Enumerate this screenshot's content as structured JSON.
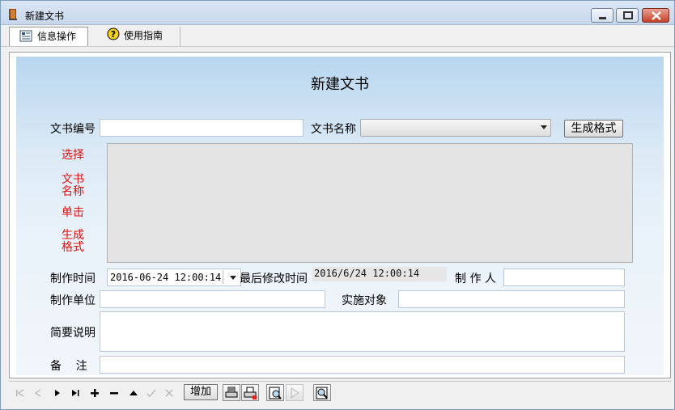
{
  "window": {
    "title": "新建文书"
  },
  "tabs": [
    {
      "label": "信息操作",
      "icon": "info-list-icon"
    },
    {
      "label": "使用指南",
      "icon": "help-icon"
    }
  ],
  "form": {
    "title": "新建文书",
    "doc_number_label": "文书编号",
    "doc_number_value": "",
    "doc_name_label": "文书名称",
    "doc_name_value": "",
    "generate_button": "生成格式",
    "hint_lines": [
      "选择",
      "文书\n名称",
      "单击",
      "生成\n格式"
    ],
    "created_time_label": "制作时间",
    "created_time_value": "2016-06-24 12:00:14",
    "modified_time_label": "最后修改时间",
    "modified_time_value": "2016/6/24 12:00:14",
    "author_label": "制 作 人",
    "author_value": "",
    "unit_label": "制作单位",
    "unit_value": "",
    "target_label": "实施对象",
    "target_value": "",
    "summary_label": "简要说明",
    "summary_value": "",
    "remark_label": "备    注",
    "remark_value": ""
  },
  "navigator": {
    "add_label": "增加",
    "buttons": [
      "first-record-icon",
      "prev-record-icon",
      "next-record-icon",
      "last-record-icon",
      "insert-record-icon",
      "delete-record-icon",
      "edit-record-icon",
      "post-record-icon",
      "cancel-record-icon"
    ]
  },
  "colors": {
    "hint_red": "#e01010",
    "panel_top": "#b8d6ee",
    "panel_bottom": "#f1f6fb"
  }
}
